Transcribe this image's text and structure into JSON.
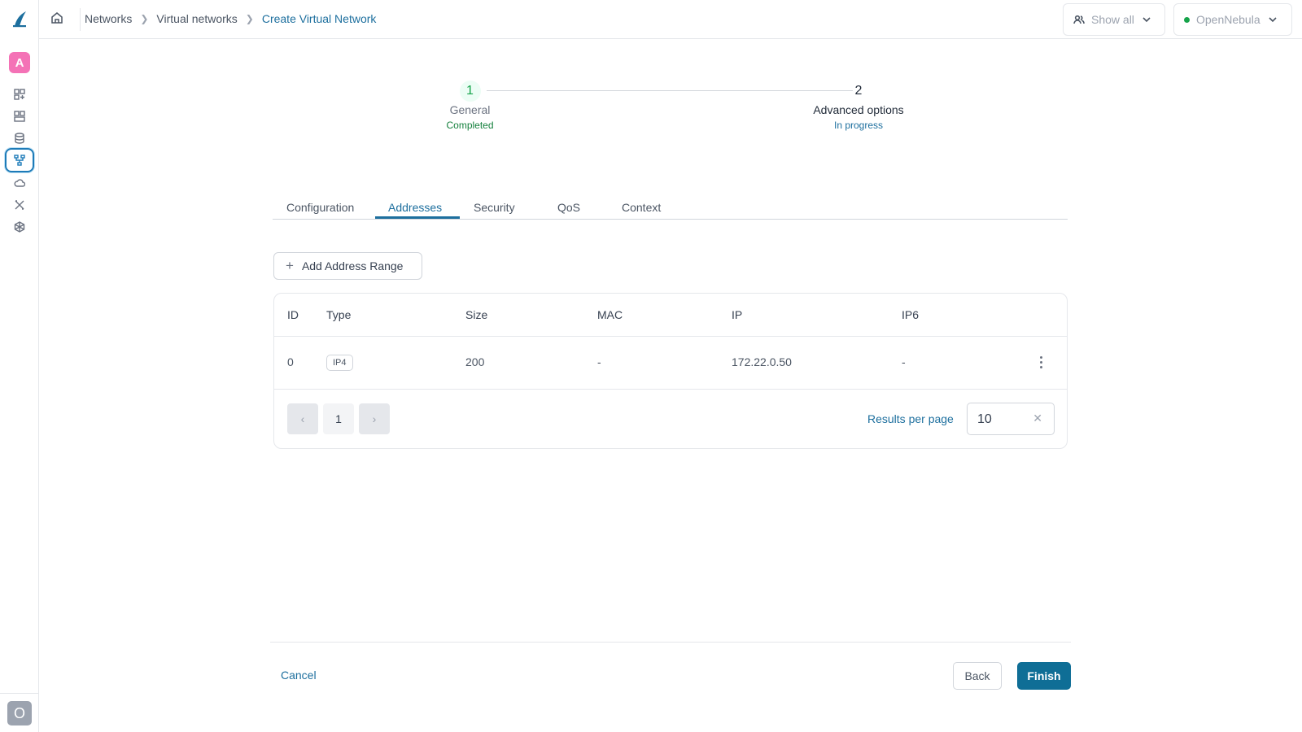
{
  "sidebar": {
    "logo": "opennebula-logo",
    "avatar_letter": "A",
    "user_letter": "O",
    "items": [
      {
        "icon": "dashboard-icon"
      },
      {
        "icon": "templates-icon"
      },
      {
        "icon": "storage-icon"
      },
      {
        "icon": "network-icon",
        "active": true
      },
      {
        "icon": "cloud-icon"
      },
      {
        "icon": "tools-icon"
      },
      {
        "icon": "cube-icon"
      }
    ]
  },
  "header": {
    "breadcrumb": [
      "Networks",
      "Virtual networks",
      "Create Virtual Network"
    ],
    "show_all_label": "Show all",
    "cloud_label": "OpenNebula",
    "accent": "#1d6f9e"
  },
  "stepper": {
    "steps": [
      {
        "number": "1",
        "title": "General",
        "status": "Completed"
      },
      {
        "number": "2",
        "title": "Advanced options",
        "status": "In progress"
      }
    ]
  },
  "tabs": [
    "Configuration",
    "Addresses",
    "Security",
    "QoS",
    "Context"
  ],
  "active_tab": "Addresses",
  "add_button_label": "Add Address Range",
  "table": {
    "headers": [
      "ID",
      "Type",
      "Size",
      "MAC",
      "IP",
      "IP6"
    ],
    "rows": [
      {
        "id": "0",
        "type": "IP4",
        "size": "200",
        "mac": "-",
        "ip": "172.22.0.50",
        "ip6": "-"
      }
    ],
    "pagination": {
      "current_page": "1"
    },
    "results_per_page_label": "Results per page",
    "results_per_page": "10"
  },
  "footer": {
    "cancel_label": "Cancel",
    "back_label": "Back",
    "finish_label": "Finish"
  }
}
